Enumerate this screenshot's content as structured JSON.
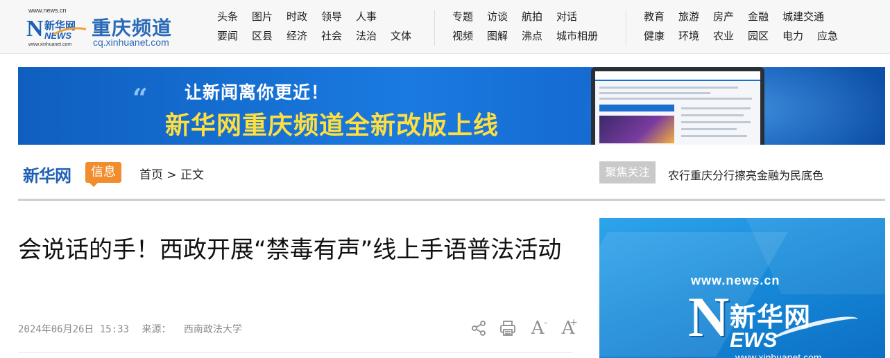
{
  "header": {
    "logo_url_top": "www.news.cn",
    "logo_url_bottom": "www.xinhuanet.com",
    "logo_mark_cn": "新华网",
    "logo_mark_en": "NEWS",
    "channel_name": "重庆频道",
    "channel_domain": "cq.xinhuanet.com",
    "nav_group_1": [
      [
        "头条",
        "图片",
        "时政",
        "领导",
        "人事"
      ],
      [
        "要闻",
        "区县",
        "经济",
        "社会",
        "法治",
        "文体"
      ]
    ],
    "nav_group_2": [
      [
        "专题",
        "访谈",
        "航拍",
        "对话"
      ],
      [
        "视频",
        "图解",
        "沸点",
        "城市相册"
      ]
    ],
    "nav_group_3": [
      [
        "教育",
        "旅游",
        "房产",
        "金融",
        "城建交通"
      ],
      [
        "健康",
        "环境",
        "农业",
        "园区",
        "电力",
        "应急"
      ]
    ]
  },
  "banner": {
    "line1": "让新闻离你更近！",
    "line2": "新华网重庆频道全新改版上线",
    "accent": "#ffdf3f",
    "bg": "#1a7ae0"
  },
  "section": {
    "brand_cn": "新华网",
    "brand_tag": "信息",
    "breadcrumb_home": "首页",
    "breadcrumb_sep": ">",
    "breadcrumb_current": "正文",
    "focus_label": "聚焦关注",
    "focus_headline": "农行重庆分行擦亮金融为民底色"
  },
  "article": {
    "title": "会说话的手！西政开展“禁毒有声”线上手语普法活动",
    "datetime": "2024年06月26日 15:33",
    "source_label": "来源：",
    "source": "西南政法大学",
    "tools": [
      "share-icon",
      "print-icon",
      "font-decrease-icon",
      "font-increase-icon"
    ],
    "font_small": "A",
    "font_small_mark": "-",
    "font_large": "A",
    "font_large_mark": "+"
  },
  "side_ad": {
    "url_top": "www.news.cn",
    "mark_cn": "新华网",
    "mark_letter": "N",
    "mark_rest": "EWS",
    "url_bottom": "www.xinhuanet.com"
  }
}
